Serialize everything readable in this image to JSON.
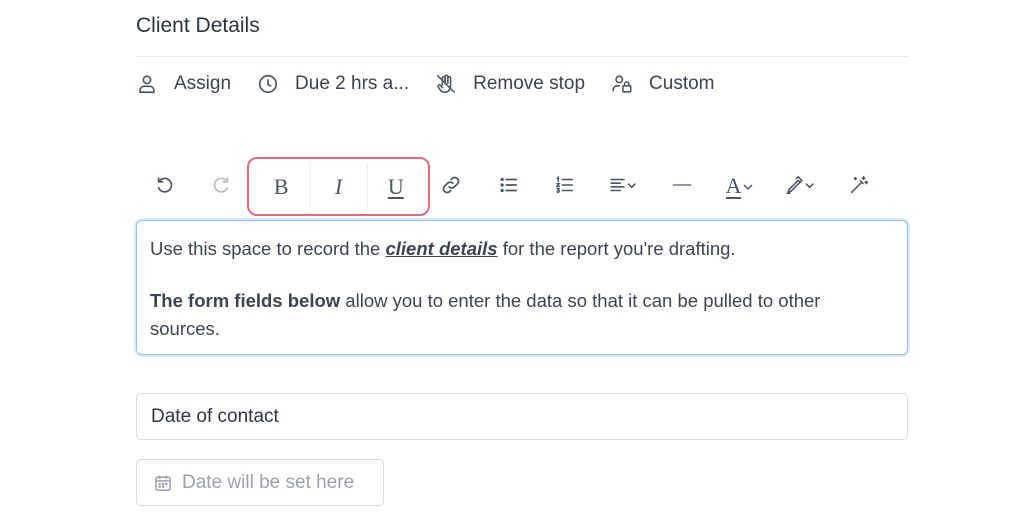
{
  "section": {
    "title": "Client Details"
  },
  "actions": [
    {
      "label": "Assign",
      "icon": "user-icon"
    },
    {
      "label": "Due 2 hrs a...",
      "icon": "clock-icon"
    },
    {
      "label": "Remove stop",
      "icon": "hand-stop-icon"
    },
    {
      "label": "Custom",
      "icon": "user-lock-icon"
    }
  ],
  "toolbar": {
    "bold": "B",
    "italic": "I",
    "underline": "U",
    "text_color": "A",
    "icons": [
      "undo-icon",
      "redo-icon",
      "bold-icon",
      "italic-icon",
      "underline-icon",
      "link-icon",
      "bullet-list-icon",
      "numbered-list-icon",
      "align-icon",
      "horizontal-rule-icon",
      "text-color-icon",
      "highlight-icon",
      "magic-wand-icon"
    ]
  },
  "editor": {
    "p1_before": "Use this space to record the ",
    "p1_emph": "client details",
    "p1_after": " for the report you're drafting.",
    "p2_bold": "The form fields below",
    "p2_after": " allow you to enter the data so that it can be pulled to other sources."
  },
  "form": {
    "field_label": "Date of contact",
    "date_placeholder": "Date will be set here",
    "date_icon": "calendar-icon"
  },
  "colors": {
    "highlight_border": "#e26a7f",
    "focus_border": "#8ec1f0",
    "text": "#3b4450",
    "muted": "#9aa1ab"
  }
}
